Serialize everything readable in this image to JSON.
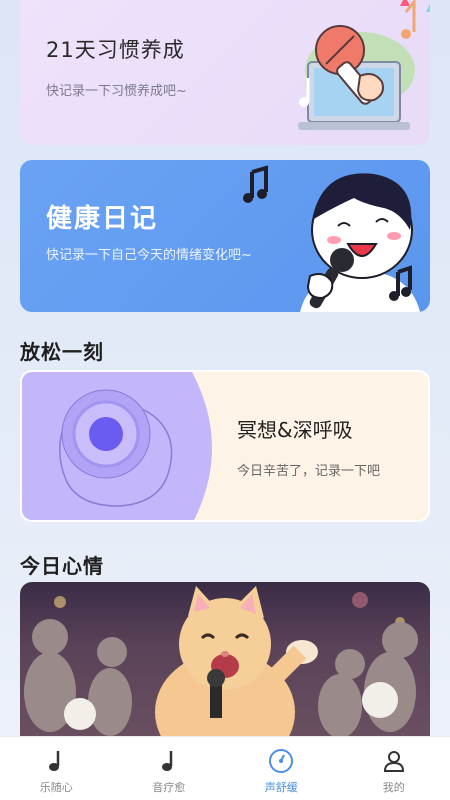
{
  "cards": {
    "habit": {
      "title": "21天习惯养成",
      "subtitle": "快记录一下习惯养成吧~"
    },
    "health": {
      "title": "健康日记",
      "subtitle": "快记录一下自己今天的情绪变化吧~"
    },
    "relax": {
      "title": "冥想&深呼吸",
      "subtitle": "今日辛苦了，记录一下吧"
    }
  },
  "sections": {
    "relax_title": "放松一刻",
    "mood_title": "今日心情"
  },
  "tabbar": {
    "items": [
      {
        "label": "乐随心",
        "icon": "music-note-icon",
        "active": false
      },
      {
        "label": "音疗愈",
        "icon": "music-note-icon",
        "active": false
      },
      {
        "label": "声舒缓",
        "icon": "gauge-icon",
        "active": true
      },
      {
        "label": "我的",
        "icon": "user-icon",
        "active": false
      }
    ]
  },
  "colors": {
    "accent": "#4a90e2",
    "health_card": "#5b96ee",
    "habit_card": "#ebdefa",
    "relax_card": "#fdf3e6",
    "relax_circle": "#6a5cf0"
  }
}
